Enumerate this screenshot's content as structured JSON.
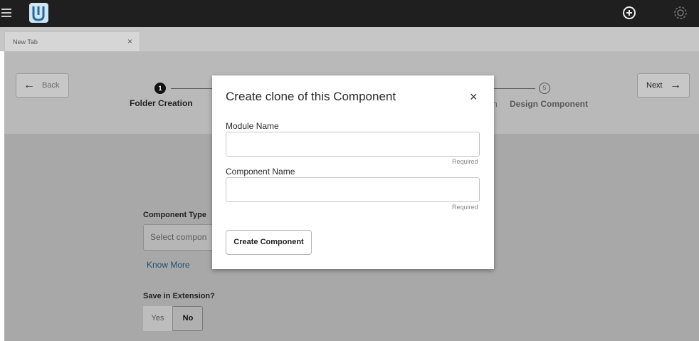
{
  "tab": {
    "label": "New Tab",
    "close": "×"
  },
  "nav": {
    "back_label": "Back",
    "back_arrow": "←",
    "next_label": "Next",
    "next_arrow": "→"
  },
  "steps": [
    {
      "number": "1",
      "label": "Folder Creation"
    },
    {
      "number": "5",
      "label": "Design Component"
    }
  ],
  "step4_fragment": "n",
  "form": {
    "component_type_label": "Component Type",
    "component_type_value": "Select compon",
    "know_more": "Know More",
    "save_in_extension_label": "Save in Extension?",
    "yes": "Yes",
    "no": "No"
  },
  "modal": {
    "title": "Create clone of this Component",
    "close": "×",
    "module_name_label": "Module Name",
    "module_name_value": "",
    "module_required": "Required",
    "component_name_label": "Component Name",
    "component_name_value": "",
    "component_required": "Required",
    "create_button": "Create Component"
  },
  "icons": [
    "menu-icon",
    "app-logo",
    "plus-circle-icon",
    "gear-icon"
  ]
}
